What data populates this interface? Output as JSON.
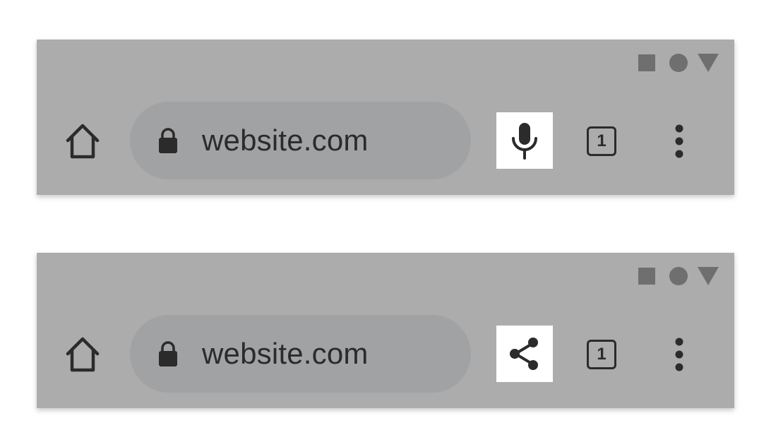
{
  "bars": [
    {
      "id": "top",
      "url": "website.com",
      "action_icon": "microphone-icon",
      "tab_count": "1"
    },
    {
      "id": "bottom",
      "url": "website.com",
      "action_icon": "share-icon",
      "tab_count": "1"
    }
  ],
  "colors": {
    "bar_background": "#acacac",
    "omnibox_background": "#a1a2a4",
    "icon_color": "#2b2b2b",
    "status_icon_color": "#6f6f6f",
    "highlight_background": "#ffffff"
  }
}
